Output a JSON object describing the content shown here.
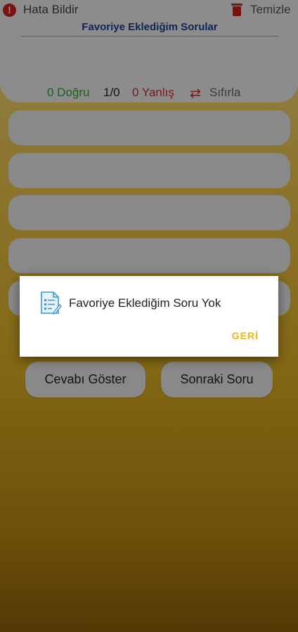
{
  "header": {
    "report_label": "Hata Bildir",
    "report_icon": "alert-circle-icon",
    "clear_label": "Temizle",
    "clear_icon": "trash-icon",
    "title": "Favoriye Eklediğim Sorular"
  },
  "score": {
    "correct": "0 Doğru",
    "progress": "1/0",
    "wrong": "0 Yanlış",
    "reset_icon": "repeat-icon",
    "reset_label": "Sıfırla"
  },
  "options": [
    "",
    "",
    "",
    "",
    ""
  ],
  "buttons": {
    "show_answer": "Cevabı Göster",
    "next_question": "Sonraki Soru"
  },
  "dialog": {
    "icon": "document-list-icon",
    "message": "Favoriye Eklediğim Soru Yok",
    "back_label": "GERİ"
  },
  "colors": {
    "title": "#1f3f94",
    "correct": "#35a53a",
    "wrong": "#d32f2f",
    "accent": "#f0b51a",
    "background_top": "#f8e08c",
    "background_bottom": "#8f640a"
  }
}
